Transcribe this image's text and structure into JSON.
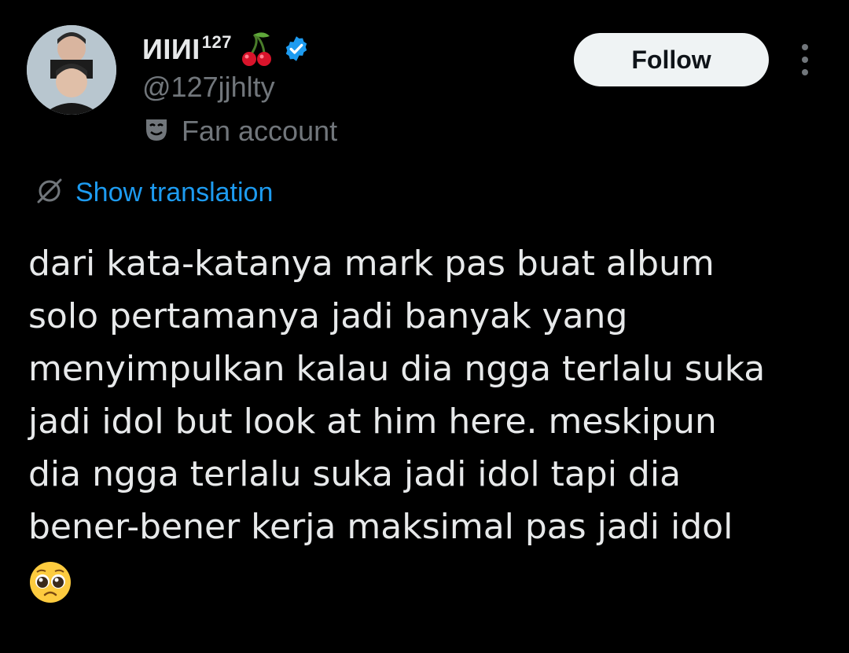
{
  "author": {
    "display_name": "ИIИI",
    "display_name_sup": "127",
    "handle": "@127jjhlty",
    "affiliation_label": "Fan account",
    "avatar_icon": "avatar-photo",
    "verified_icon": "verified-badge-icon",
    "emoji_icon": "cherry-icon"
  },
  "actions": {
    "follow_label": "Follow",
    "more_icon": "more-options-icon"
  },
  "translation": {
    "label": "Show translation",
    "icon": "globe-icon"
  },
  "tweet": {
    "lines": [
      "dari kata-katanya mark pas buat album",
      "solo pertamanya jadi banyak yang",
      "menyimpulkan kalau dia ngga terlalu suka",
      "jadi idol but look at him here. meskipun",
      "dia ngga terlalu suka jadi idol tapi dia",
      "bener-bener kerja maksimal pas jadi idol"
    ],
    "emoji": "pleading-face-emoji"
  },
  "colors": {
    "background": "#000000",
    "text": "#e7e9ea",
    "secondary": "#71767b",
    "link": "#1d9bf0",
    "verified": "#1d9bf0",
    "follow_bg": "#eff3f4"
  }
}
